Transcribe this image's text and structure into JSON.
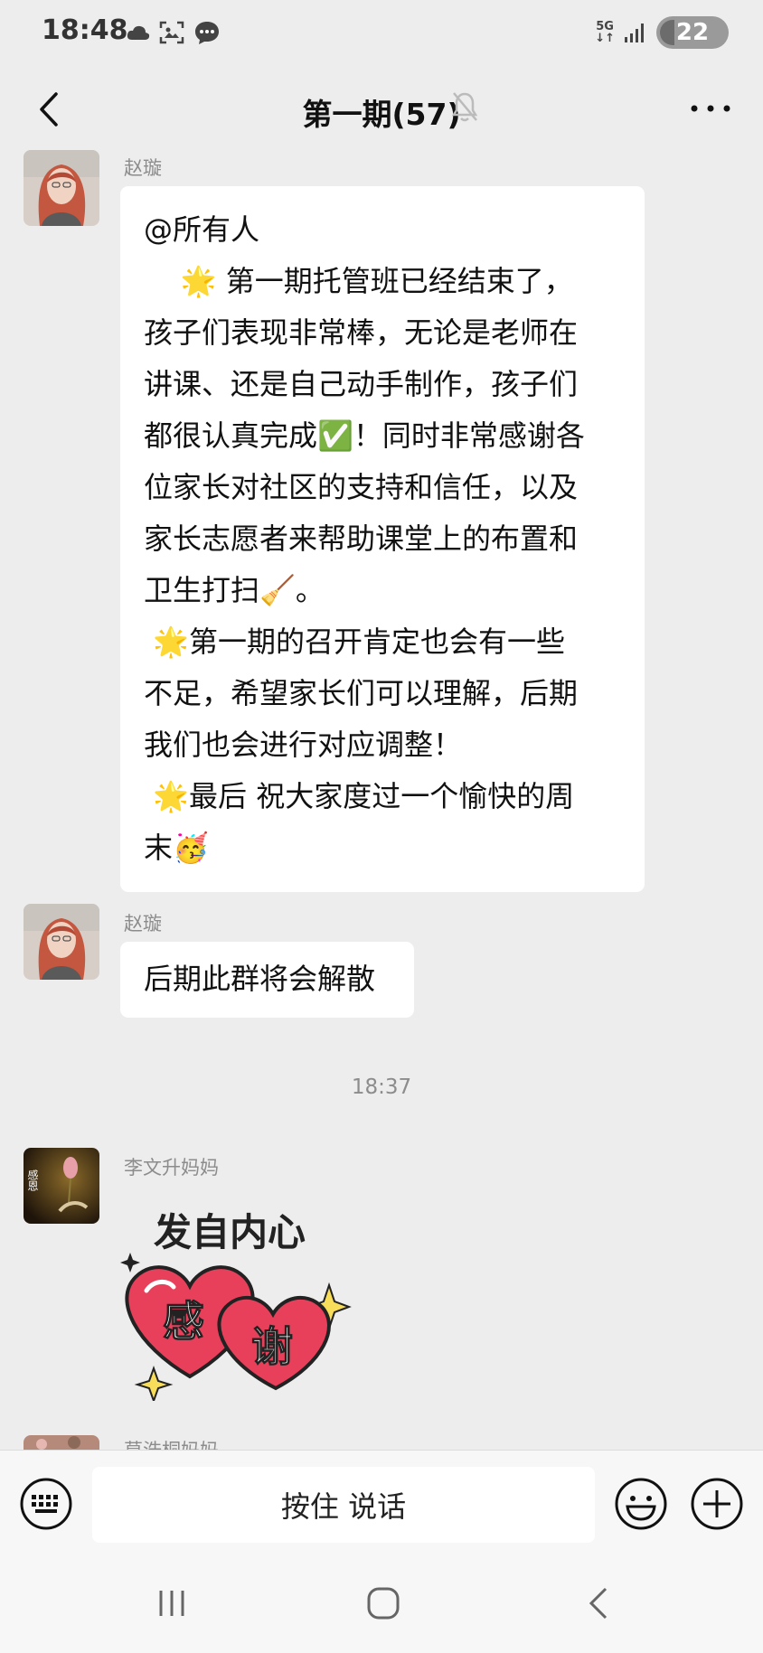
{
  "status_bar": {
    "time": "18:48",
    "network": "5G",
    "battery": "22"
  },
  "nav": {
    "title": "第一期(57)"
  },
  "messages": [
    {
      "sender": "赵璇",
      "lines": [
        "@所有人",
        "    🌟 第一期托管班已经结束了，",
        "孩子们表现非常棒，无论是老师在",
        "讲课、还是自己动手制作，孩子们",
        "都很认真完成✅！同时非常感谢各",
        "位家长对社区的支持和信任，以及",
        "家长志愿者来帮助课堂上的布置和",
        "卫生打扫🧹。",
        " 🌟第一期的召开肯定也会有一些",
        "不足，希望家长们可以理解，后期",
        "我们也会进行对应调整！",
        " 🌟最后 祝大家度过一个愉快的周",
        "末🥳"
      ]
    },
    {
      "sender": "赵璇",
      "text": "后期此群将会解散"
    }
  ],
  "timestamp": "18:37",
  "sticker_message": {
    "sender": "李文升妈妈",
    "avatar_text": "感恩",
    "sticker_top": "发自内心",
    "sticker_left": "感",
    "sticker_right": "谢"
  },
  "partial_sender": "莫浩桐妈妈",
  "input_bar": {
    "voice_label": "按住 说话"
  },
  "colors": {
    "background": "#ededed",
    "bubble": "#ffffff",
    "heart": "#e8405a"
  }
}
